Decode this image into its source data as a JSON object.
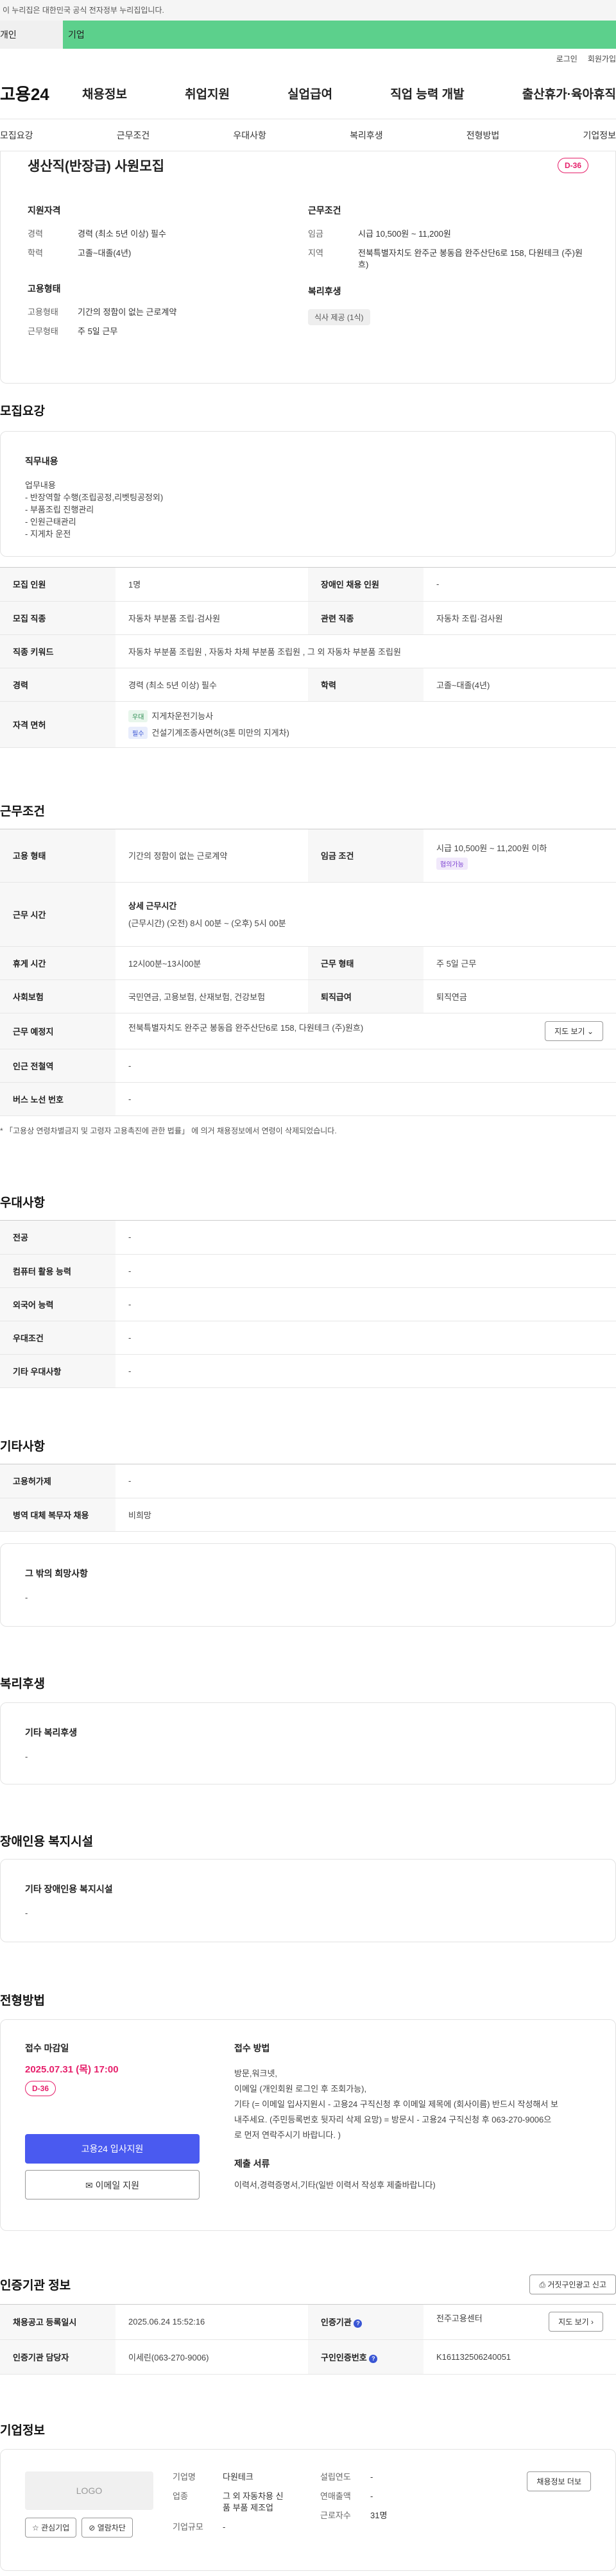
{
  "gov_banner": "이 누리집은 대한민국 공식 전자정부 누리집입니다.",
  "user_tabs": {
    "person": "개인",
    "corp": "기업"
  },
  "util": {
    "login": "로그인",
    "join": "회원가입"
  },
  "gnb": {
    "logo": "고용24",
    "items": [
      "채용정보",
      "취업지원",
      "실업급여",
      "직업 능력 개발",
      "출산휴가·육아휴직"
    ]
  },
  "snb": [
    "모집요강",
    "근무조건",
    "우대사항",
    "복리후생",
    "전형방법",
    "기업정보"
  ],
  "summary": {
    "title": "생산직(반장급) 사원모집",
    "dday": "D-36",
    "left": {
      "h1": "지원자격",
      "rows": [
        {
          "k": "경력",
          "v": "경력 (최소 5년 이상) 필수"
        },
        {
          "k": "학력",
          "v": "고졸~대졸(4년)"
        }
      ],
      "h2": "고용형태",
      "rows2": [
        {
          "k": "고용형태",
          "v": "기간의 정함이 없는 근로계약"
        },
        {
          "k": "근무형태",
          "v": "주 5일 근무"
        }
      ]
    },
    "right": {
      "h1": "근무조건",
      "rows": [
        {
          "k": "임금",
          "v": "시급 10,500원 ~ 11,200원"
        },
        {
          "k": "지역",
          "v": "전북특별자치도 완주군 봉동읍 완주산단6로 158, 다원테크 (주)원흐)"
        }
      ],
      "h2": "복리후생",
      "tag": "식사 제공 (1식)"
    }
  },
  "recruit": {
    "title": "모집요강",
    "duty_h": "직무내용",
    "duty_lines": [
      "업무내용",
      "- 반장역할 수행(조립공정,리벳팅공정외)",
      "- 부품조립 진행관리",
      "- 인원근태관리",
      "- 지게차 운전"
    ],
    "rows": [
      {
        "k1": "모집 인원",
        "v1": "1명",
        "k2": "장애인 채용 인원",
        "v2": "-"
      },
      {
        "k1": "모집 직종",
        "v1": "자동차 부분품 조립·검사원",
        "k2": "관련 직종",
        "v2": "자동차 조립·검사원"
      },
      {
        "k1": "직종 키워드",
        "v1": "자동차 부분품 조립원 , 자동차 차체 부분품 조립원 , 그 외 자동차 부분품 조립원"
      },
      {
        "k1": "경력",
        "v1": "경력 (최소 5년 이상) 필수",
        "k2": "학력",
        "v2": "고졸~대졸(4년)"
      }
    ],
    "license_k": "자격 면허",
    "licenses": [
      {
        "badge": "우대",
        "name": "지게차운전기능사"
      },
      {
        "badge": "필수",
        "name": "건설기계조종사면허(3톤 미만의 지게차)"
      }
    ]
  },
  "work": {
    "title": "근무조건",
    "emp_k": "고용 형태",
    "emp_v": "기간의 정함이 없는 근로계약",
    "wage_k": "임금 조건",
    "wage_v": "시급 10,500원 ~ 11,200원 이하",
    "wage_badge": "협의가능",
    "time_k": "근무 시간",
    "time_h": "상세 근무시간",
    "time_v": "(근무시간) (오전) 8시 00분 ~ (오후) 5시 00분",
    "rest_k": "휴게 시간",
    "rest_v": "12시00분~13시00분",
    "form_k": "근무 형태",
    "form_v": "주 5일 근무",
    "ins_k": "사회보험",
    "ins_v": "국민연금, 고용보험, 산재보험, 건강보험",
    "ret_k": "퇴직급여",
    "ret_v": "퇴직연금",
    "place_k": "근무 예정지",
    "place_v": "전북특별자치도 완주군 봉동읍 완주산단6로 158, 다원테크 (주)원흐)",
    "map_btn": "지도 보기",
    "sub_k": "인근 전철역",
    "sub_v": "-",
    "bus_k": "버스 노선 번호",
    "bus_v": "-",
    "note": "* 「고용상 연령차별금지 및 고령자 고용촉진에 관한 법률」 에 의거 채용정보에서 연령이 삭제되었습니다."
  },
  "pref": {
    "title": "우대사항",
    "rows": [
      {
        "k": "전공",
        "v": "-"
      },
      {
        "k": "컴퓨터 활용 능력",
        "v": "-"
      },
      {
        "k": "외국어 능력",
        "v": "-"
      },
      {
        "k": "우대조건",
        "v": "-"
      },
      {
        "k": "기타 우대사항",
        "v": "-"
      }
    ]
  },
  "etc": {
    "title": "기타사항",
    "rows": [
      {
        "k": "고용허가제",
        "v": "-"
      },
      {
        "k": "병역 대체 복무자 채용",
        "v": "비희망"
      }
    ],
    "other_h": "그 밖의 희망사항",
    "other_v": "-"
  },
  "welfare": {
    "title": "복리후생",
    "h": "기타 복리후생",
    "v": "-"
  },
  "disabled": {
    "title": "장애인용 복지시설",
    "h": "기타 장애인용 복지시설",
    "v": "-"
  },
  "screen": {
    "title": "전형방법",
    "deadline_h": "접수 마감일",
    "deadline": "2025.07.31 (목) 17:00",
    "dday": "D-36",
    "apply_btn": "고용24 입사지원",
    "email_btn": "이메일 지원",
    "method_h": "접수 방법",
    "method_lines": [
      "방문,워크넷,",
      "이메일 (개인회원 로그인 후 조회가능),",
      "기타 (= 이메일 입사지원시 - 고용24 구직신청 후 이메일 제목에 (회사이름) 반드시 작성해서 보",
      "내주세요. (주민등록번호 뒷자리 삭제 요망) = 방문시 - 고용24 구직신청 후 063-270-9006으",
      "로 먼저 연락주시기 바랍니다. )"
    ],
    "docs_h": "제출 서류",
    "docs_v": "이력서,경력증명서,기타(일반 이력서 작성후 제출바랍니다)"
  },
  "agency": {
    "title": "인증기관 정보",
    "report_btn": "거짓구인광고 신고",
    "reg_k": "채용공고 등록일시",
    "reg_v": "2025.06.24 15:52:16",
    "org_k": "인증기관",
    "org_v": "전주고용센터",
    "map_btn": "지도 보기",
    "mgr_k": "인증기관 담당자",
    "mgr_v": "이세린(063-270-9006)",
    "id_k": "구인인증번호",
    "id_v": "K161132506240051"
  },
  "company": {
    "title": "기업정보",
    "logo": "LOGO",
    "fav_btn": "관심기업",
    "block_btn": "열람차단",
    "name_k": "기업명",
    "name_v": "다원테크",
    "year_k": "설립연도",
    "year_v": "-",
    "ind_k": "업종",
    "ind_v1": "그 외 자동차용 신",
    "ind_v2": "품 부품 제조업",
    "sales_k": "연매출액",
    "sales_v": "-",
    "emp_k": "근로자수",
    "emp_v": "31명",
    "scale_k": "기업규모",
    "scale_v": "-",
    "more_btn": "채용정보 더보"
  }
}
